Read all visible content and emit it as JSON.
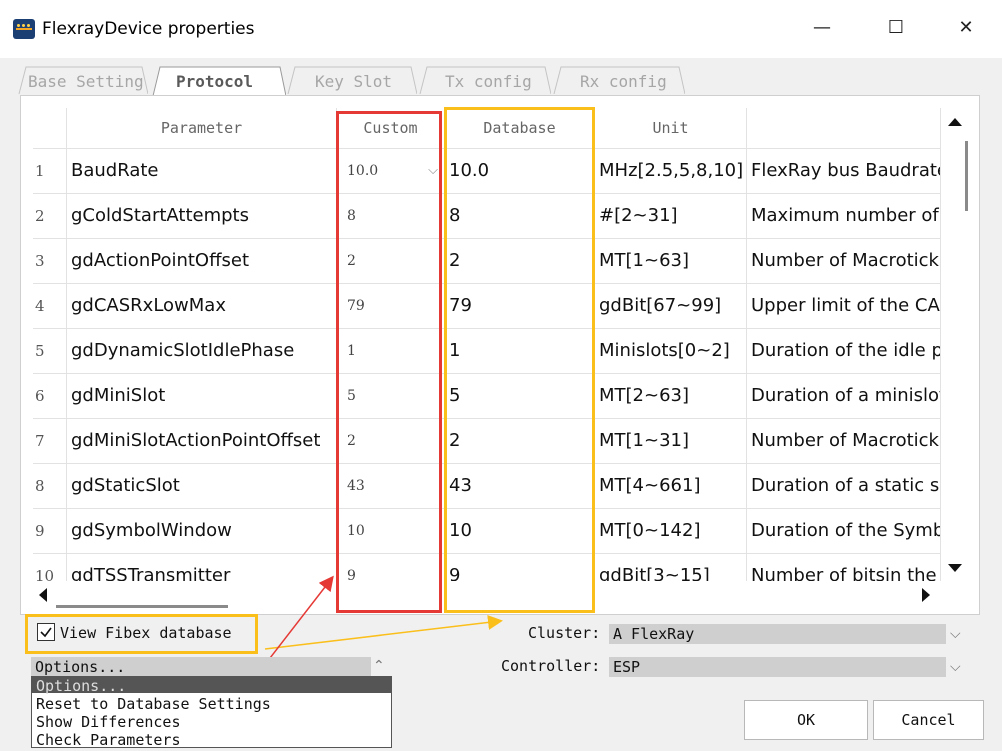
{
  "window": {
    "title": "FlexrayDevice properties",
    "controls": {
      "minimize": "—",
      "maximize": "☐",
      "close": "✕"
    }
  },
  "tabs": [
    "Base Setting",
    "Protocol",
    "Key Slot",
    "Tx config",
    "Rx config"
  ],
  "active_tab": "Protocol",
  "grid": {
    "headers": [
      "Parameter",
      "Custom",
      "Database",
      "Unit",
      ""
    ],
    "rows": [
      {
        "n": "1",
        "param": "BaudRate",
        "custom": "10.0",
        "db": "10.0",
        "unit": "MHz[2.5,5,8,10]",
        "desc": "FlexRay bus Baudrate"
      },
      {
        "n": "2",
        "param": "gColdStartAttempts",
        "custom": "8",
        "db": "8",
        "unit": "#[2~31]",
        "desc": "Maximum number of t"
      },
      {
        "n": "3",
        "param": "gdActionPointOffset",
        "custom": "2",
        "db": "2",
        "unit": "MT[1~63]",
        "desc": "Number of Macroticks"
      },
      {
        "n": "4",
        "param": "gdCASRxLowMax",
        "custom": "79",
        "db": "79",
        "unit": "gdBit[67~99]",
        "desc": "Upper limit of the CAS"
      },
      {
        "n": "5",
        "param": "gdDynamicSlotIdlePhase",
        "custom": "1",
        "db": "1",
        "unit": "Minislots[0~2]",
        "desc": "Duration of the idle ph"
      },
      {
        "n": "6",
        "param": "gdMiniSlot",
        "custom": "5",
        "db": "5",
        "unit": "MT[2~63]",
        "desc": "Duration of a minislot"
      },
      {
        "n": "7",
        "param": "gdMiniSlotActionPointOffset",
        "custom": "2",
        "db": "2",
        "unit": "MT[1~31]",
        "desc": "Number of Macroticks"
      },
      {
        "n": "8",
        "param": "gdStaticSlot",
        "custom": "43",
        "db": "43",
        "unit": "MT[4~661]",
        "desc": "Duration of a static slo"
      },
      {
        "n": "9",
        "param": "gdSymbolWindow",
        "custom": "10",
        "db": "10",
        "unit": "MT[0~142]",
        "desc": "Duration of the Symbo"
      },
      {
        "n": "10",
        "param": "gdTSSTransmitter",
        "custom": "9",
        "db": "9",
        "unit": "gdBit[3~15]",
        "desc": "Number of bitsin the T"
      }
    ]
  },
  "view_fibex": {
    "label": "View Fibex database",
    "checked": true
  },
  "cluster": {
    "label": "Cluster:",
    "value": "A FlexRay"
  },
  "controller": {
    "label": "Controller:",
    "value": "ESP"
  },
  "options": {
    "value": "Options...",
    "items": [
      "Options...",
      "Reset to Database Settings",
      "Show Differences",
      "Check Parameters"
    ]
  },
  "buttons": {
    "ok": "OK",
    "cancel": "Cancel"
  },
  "colors": {
    "highlight_red": "#e53935",
    "highlight_yellow": "#fbbf1c"
  },
  "icons": {
    "window": "flexray-app-icon",
    "check": "checkmark-icon"
  }
}
